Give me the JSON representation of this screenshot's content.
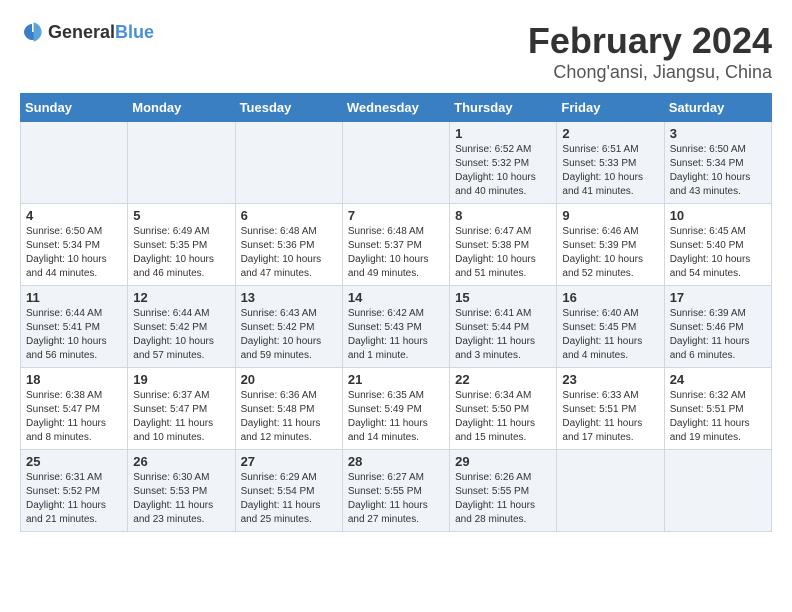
{
  "logo": {
    "text_general": "General",
    "text_blue": "Blue"
  },
  "title": "February 2024",
  "subtitle": "Chong'ansi, Jiangsu, China",
  "days_of_week": [
    "Sunday",
    "Monday",
    "Tuesday",
    "Wednesday",
    "Thursday",
    "Friday",
    "Saturday"
  ],
  "weeks": [
    [
      {
        "day": "",
        "sunrise": "",
        "sunset": "",
        "daylight": ""
      },
      {
        "day": "",
        "sunrise": "",
        "sunset": "",
        "daylight": ""
      },
      {
        "day": "",
        "sunrise": "",
        "sunset": "",
        "daylight": ""
      },
      {
        "day": "",
        "sunrise": "",
        "sunset": "",
        "daylight": ""
      },
      {
        "day": "1",
        "sunrise": "Sunrise: 6:52 AM",
        "sunset": "Sunset: 5:32 PM",
        "daylight": "Daylight: 10 hours and 40 minutes."
      },
      {
        "day": "2",
        "sunrise": "Sunrise: 6:51 AM",
        "sunset": "Sunset: 5:33 PM",
        "daylight": "Daylight: 10 hours and 41 minutes."
      },
      {
        "day": "3",
        "sunrise": "Sunrise: 6:50 AM",
        "sunset": "Sunset: 5:34 PM",
        "daylight": "Daylight: 10 hours and 43 minutes."
      }
    ],
    [
      {
        "day": "4",
        "sunrise": "Sunrise: 6:50 AM",
        "sunset": "Sunset: 5:34 PM",
        "daylight": "Daylight: 10 hours and 44 minutes."
      },
      {
        "day": "5",
        "sunrise": "Sunrise: 6:49 AM",
        "sunset": "Sunset: 5:35 PM",
        "daylight": "Daylight: 10 hours and 46 minutes."
      },
      {
        "day": "6",
        "sunrise": "Sunrise: 6:48 AM",
        "sunset": "Sunset: 5:36 PM",
        "daylight": "Daylight: 10 hours and 47 minutes."
      },
      {
        "day": "7",
        "sunrise": "Sunrise: 6:48 AM",
        "sunset": "Sunset: 5:37 PM",
        "daylight": "Daylight: 10 hours and 49 minutes."
      },
      {
        "day": "8",
        "sunrise": "Sunrise: 6:47 AM",
        "sunset": "Sunset: 5:38 PM",
        "daylight": "Daylight: 10 hours and 51 minutes."
      },
      {
        "day": "9",
        "sunrise": "Sunrise: 6:46 AM",
        "sunset": "Sunset: 5:39 PM",
        "daylight": "Daylight: 10 hours and 52 minutes."
      },
      {
        "day": "10",
        "sunrise": "Sunrise: 6:45 AM",
        "sunset": "Sunset: 5:40 PM",
        "daylight": "Daylight: 10 hours and 54 minutes."
      }
    ],
    [
      {
        "day": "11",
        "sunrise": "Sunrise: 6:44 AM",
        "sunset": "Sunset: 5:41 PM",
        "daylight": "Daylight: 10 hours and 56 minutes."
      },
      {
        "day": "12",
        "sunrise": "Sunrise: 6:44 AM",
        "sunset": "Sunset: 5:42 PM",
        "daylight": "Daylight: 10 hours and 57 minutes."
      },
      {
        "day": "13",
        "sunrise": "Sunrise: 6:43 AM",
        "sunset": "Sunset: 5:42 PM",
        "daylight": "Daylight: 10 hours and 59 minutes."
      },
      {
        "day": "14",
        "sunrise": "Sunrise: 6:42 AM",
        "sunset": "Sunset: 5:43 PM",
        "daylight": "Daylight: 11 hours and 1 minute."
      },
      {
        "day": "15",
        "sunrise": "Sunrise: 6:41 AM",
        "sunset": "Sunset: 5:44 PM",
        "daylight": "Daylight: 11 hours and 3 minutes."
      },
      {
        "day": "16",
        "sunrise": "Sunrise: 6:40 AM",
        "sunset": "Sunset: 5:45 PM",
        "daylight": "Daylight: 11 hours and 4 minutes."
      },
      {
        "day": "17",
        "sunrise": "Sunrise: 6:39 AM",
        "sunset": "Sunset: 5:46 PM",
        "daylight": "Daylight: 11 hours and 6 minutes."
      }
    ],
    [
      {
        "day": "18",
        "sunrise": "Sunrise: 6:38 AM",
        "sunset": "Sunset: 5:47 PM",
        "daylight": "Daylight: 11 hours and 8 minutes."
      },
      {
        "day": "19",
        "sunrise": "Sunrise: 6:37 AM",
        "sunset": "Sunset: 5:47 PM",
        "daylight": "Daylight: 11 hours and 10 minutes."
      },
      {
        "day": "20",
        "sunrise": "Sunrise: 6:36 AM",
        "sunset": "Sunset: 5:48 PM",
        "daylight": "Daylight: 11 hours and 12 minutes."
      },
      {
        "day": "21",
        "sunrise": "Sunrise: 6:35 AM",
        "sunset": "Sunset: 5:49 PM",
        "daylight": "Daylight: 11 hours and 14 minutes."
      },
      {
        "day": "22",
        "sunrise": "Sunrise: 6:34 AM",
        "sunset": "Sunset: 5:50 PM",
        "daylight": "Daylight: 11 hours and 15 minutes."
      },
      {
        "day": "23",
        "sunrise": "Sunrise: 6:33 AM",
        "sunset": "Sunset: 5:51 PM",
        "daylight": "Daylight: 11 hours and 17 minutes."
      },
      {
        "day": "24",
        "sunrise": "Sunrise: 6:32 AM",
        "sunset": "Sunset: 5:51 PM",
        "daylight": "Daylight: 11 hours and 19 minutes."
      }
    ],
    [
      {
        "day": "25",
        "sunrise": "Sunrise: 6:31 AM",
        "sunset": "Sunset: 5:52 PM",
        "daylight": "Daylight: 11 hours and 21 minutes."
      },
      {
        "day": "26",
        "sunrise": "Sunrise: 6:30 AM",
        "sunset": "Sunset: 5:53 PM",
        "daylight": "Daylight: 11 hours and 23 minutes."
      },
      {
        "day": "27",
        "sunrise": "Sunrise: 6:29 AM",
        "sunset": "Sunset: 5:54 PM",
        "daylight": "Daylight: 11 hours and 25 minutes."
      },
      {
        "day": "28",
        "sunrise": "Sunrise: 6:27 AM",
        "sunset": "Sunset: 5:55 PM",
        "daylight": "Daylight: 11 hours and 27 minutes."
      },
      {
        "day": "29",
        "sunrise": "Sunrise: 6:26 AM",
        "sunset": "Sunset: 5:55 PM",
        "daylight": "Daylight: 11 hours and 28 minutes."
      },
      {
        "day": "",
        "sunrise": "",
        "sunset": "",
        "daylight": ""
      },
      {
        "day": "",
        "sunrise": "",
        "sunset": "",
        "daylight": ""
      }
    ]
  ]
}
